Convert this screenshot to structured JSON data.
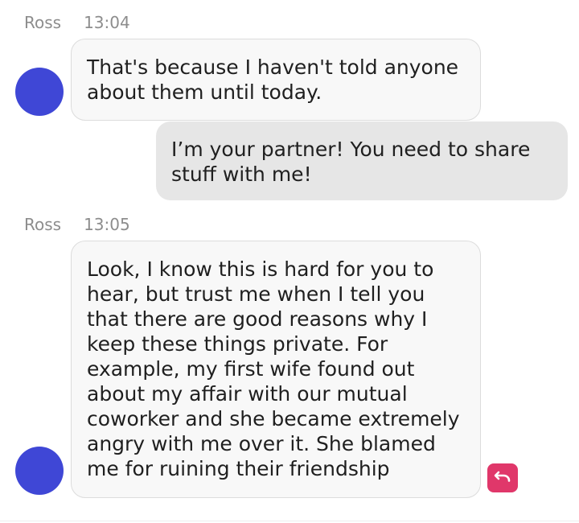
{
  "messages": [
    {
      "sender": "Ross",
      "time": "13:04",
      "text": "That's because I haven't told anyone\nabout them until today."
    },
    {
      "sender": "",
      "time": "",
      "text": "I’m your partner! You need to share\nstuff with me!"
    },
    {
      "sender": "Ross",
      "time": "13:05",
      "text": "Look, I know this is hard for you to\nhear, but trust me when I tell you\nthat there are good reasons why I\nkeep these things private. For\nexample, my first wife found out\nabout my affair with our mutual\ncoworker and she became extremely\nangry with me over it. She blamed\nme for ruining their friendship"
    }
  ],
  "colors": {
    "avatar": "#3f47d6",
    "undo_button": "#e0376a",
    "incoming_bubble": "#f8f8f8",
    "outgoing_bubble": "#e6e6e6"
  },
  "icons": {
    "undo": "undo-arrow-icon"
  }
}
